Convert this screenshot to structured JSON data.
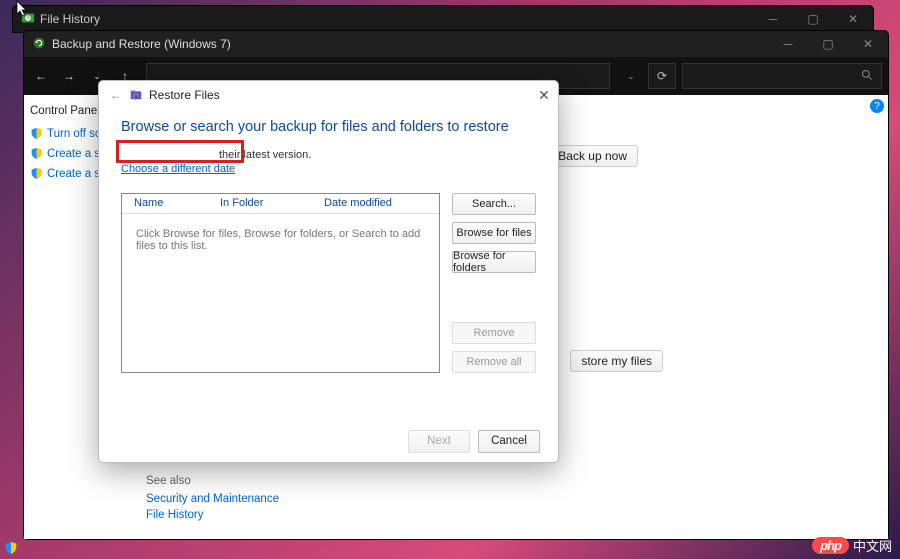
{
  "win1": {
    "title": "File History"
  },
  "win2": {
    "title": "Backup and Restore (Windows 7)",
    "left_header": "Control Panel",
    "tasks": [
      "Turn off sched",
      "Create a syste",
      "Create a syste"
    ],
    "backup_now": "Back up now",
    "restore_my": "store my files",
    "see_also_header": "See also",
    "see_also": [
      "Security and Maintenance",
      "File History"
    ]
  },
  "dialog": {
    "title": "Restore Files",
    "heading": "Browse or search your backup for files and folders to restore",
    "note_truncated": "their latest version.",
    "choose_date": "Choose a different date",
    "columns": {
      "name": "Name",
      "in_folder": "In Folder",
      "date_modified": "Date modified"
    },
    "empty_msg": "Click Browse for files, Browse for folders, or Search to add files to this list.",
    "buttons": {
      "search": "Search...",
      "browse_files": "Browse for files",
      "browse_folders": "Browse for folders",
      "remove": "Remove",
      "remove_all": "Remove all"
    },
    "footer": {
      "next": "Next",
      "cancel": "Cancel"
    }
  },
  "watermark": {
    "pill": "php",
    "text": "中文网"
  }
}
